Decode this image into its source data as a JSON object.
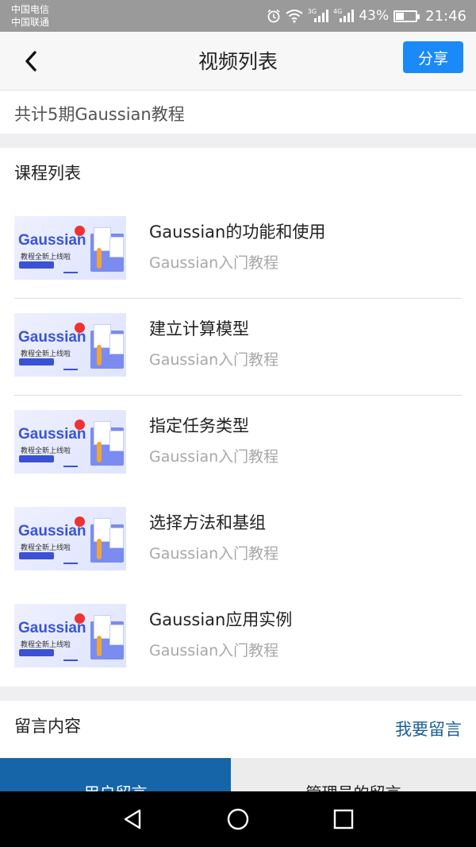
{
  "status_bar": {
    "carrier1": "中国电信",
    "carrier2": "中国联通",
    "net1": "3G",
    "net2": "4G",
    "battery_text": "43%",
    "battery_level": 0.43,
    "time": "21:46"
  },
  "header": {
    "title": "视频列表",
    "share_label": "分享"
  },
  "summary": "共计5期Gaussian教程",
  "course_list": {
    "title": "课程列表",
    "thumbnail": {
      "logo": "Gaussian",
      "tagline": "教程全新上线啦"
    },
    "items": [
      {
        "title": "Gaussian的功能和使用",
        "subtitle": "Gaussian入门教程"
      },
      {
        "title": "建立计算模型",
        "subtitle": "Gaussian入门教程"
      },
      {
        "title": "指定任务类型",
        "subtitle": "Gaussian入门教程"
      },
      {
        "title": "选择方法和基组",
        "subtitle": "Gaussian入门教程"
      },
      {
        "title": "Gaussian应用实例",
        "subtitle": "Gaussian入门教程"
      }
    ]
  },
  "comments": {
    "title": "留言内容",
    "leave_message": "我要留言",
    "tabs": [
      "用户留言",
      "管理员的留言"
    ]
  },
  "colors": {
    "accent": "#1a8af8",
    "link": "#1b5f97",
    "active_tab": "#1565a8"
  }
}
